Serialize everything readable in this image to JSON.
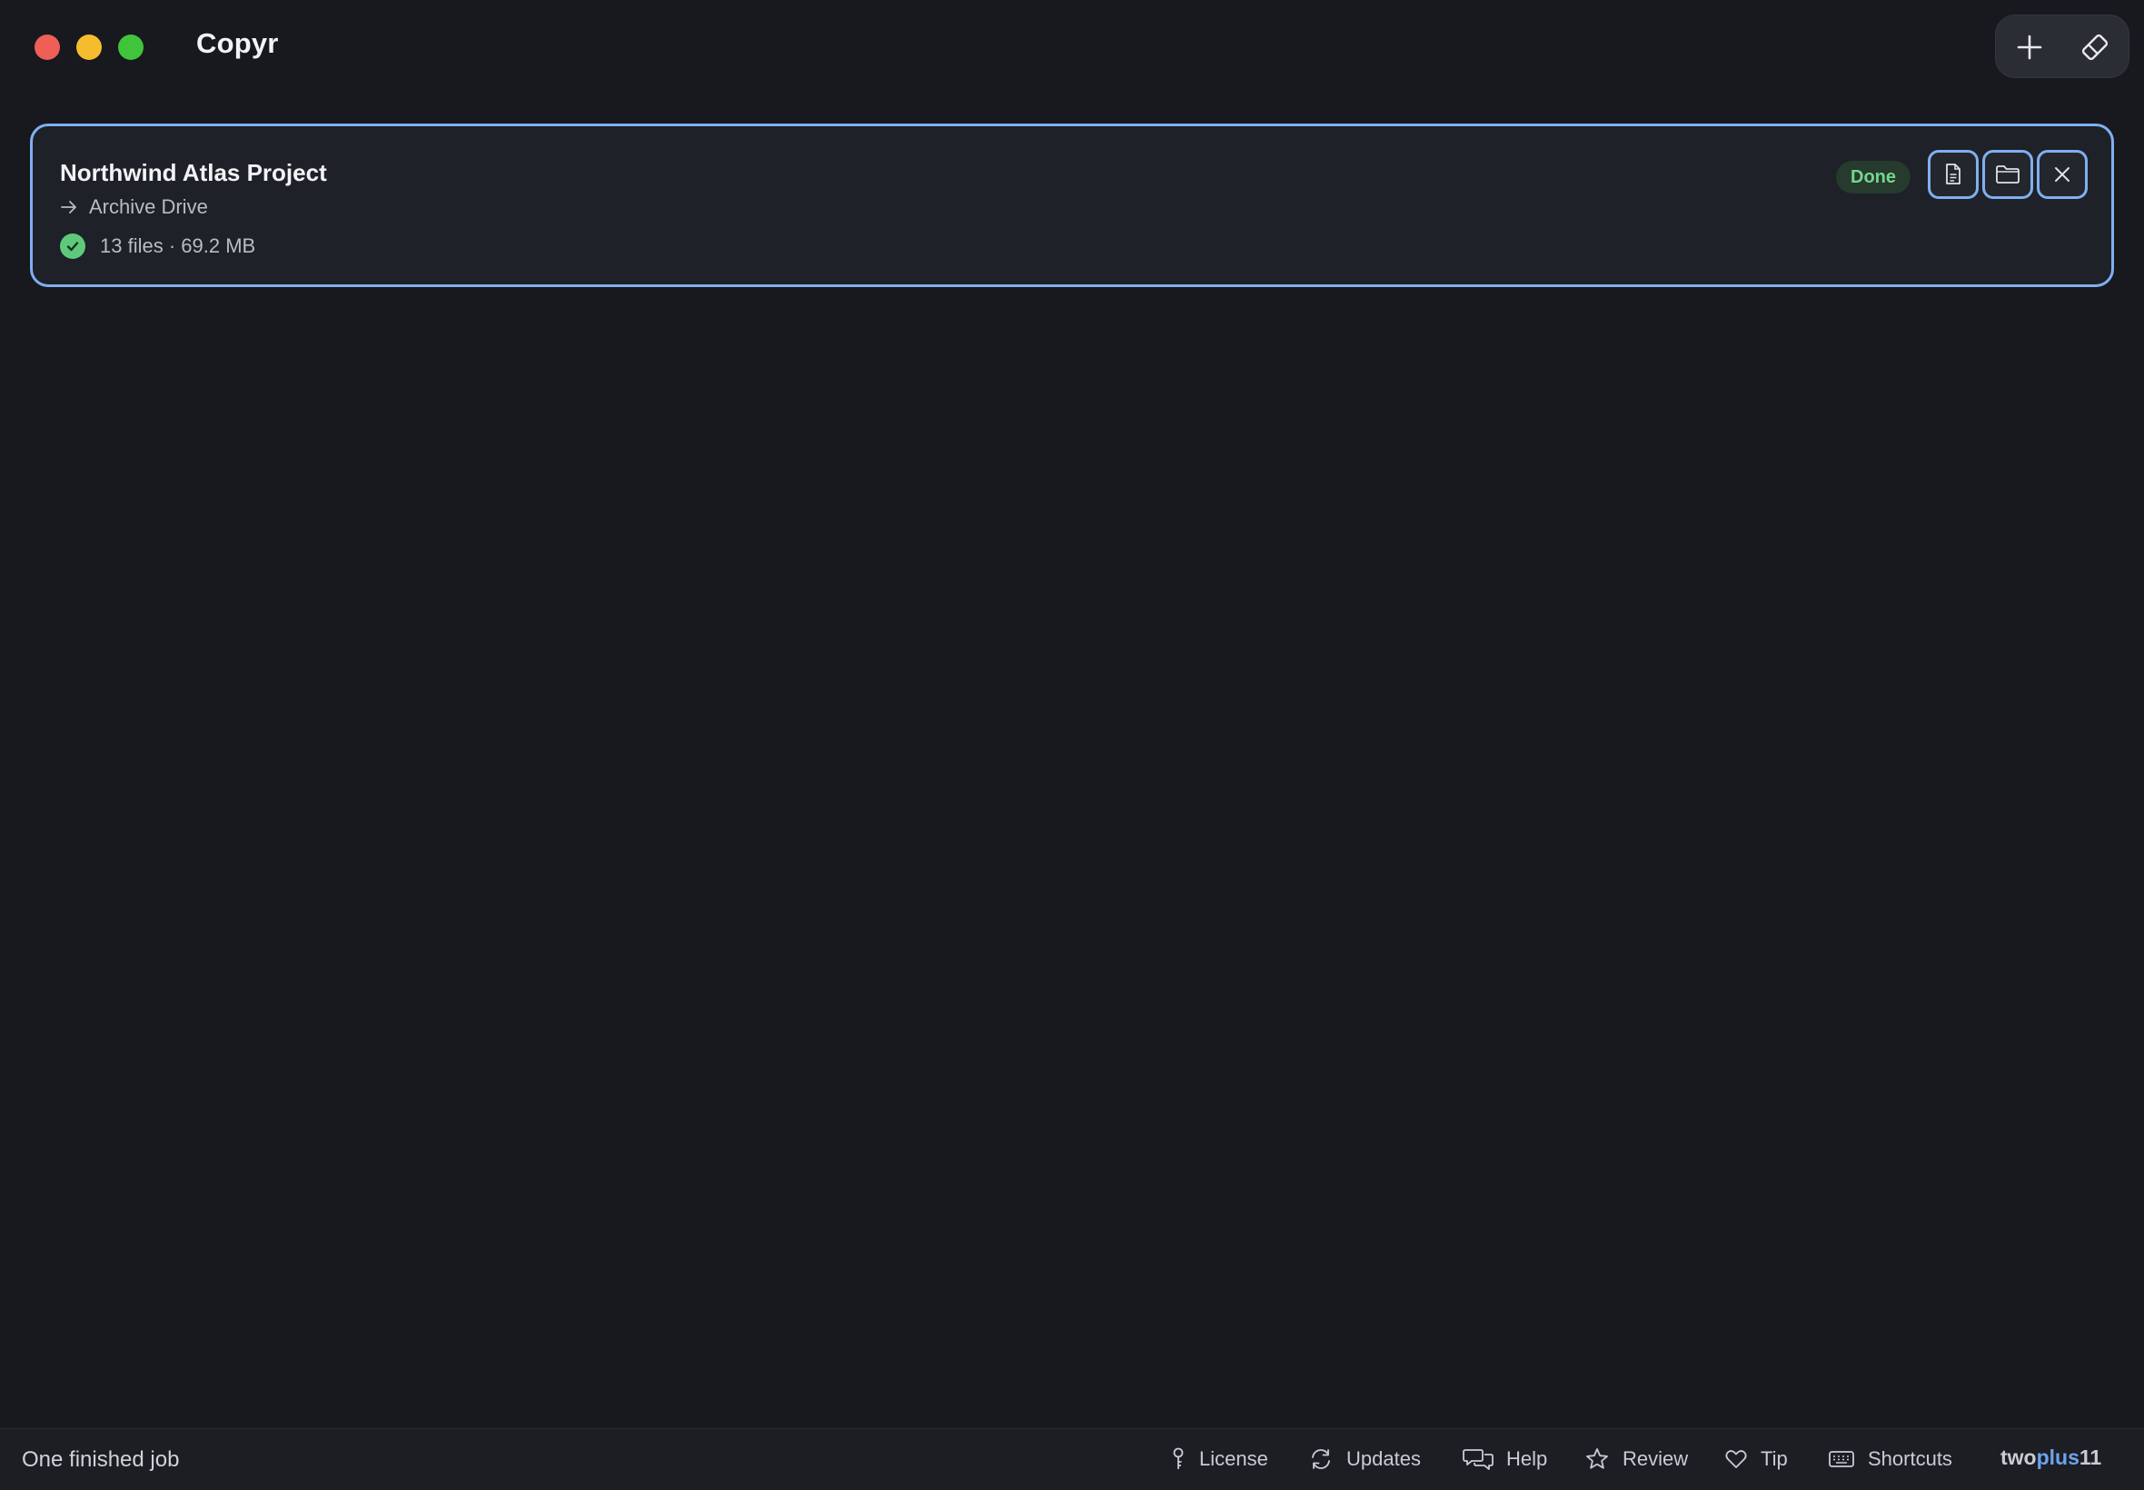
{
  "window": {
    "title": "Copyr"
  },
  "toolbar": {
    "add_icon": "plus-icon",
    "erase_icon": "eraser-icon"
  },
  "jobs": [
    {
      "title": "Northwind Atlas Project",
      "destination_arrow": "→",
      "destination": "Archive Drive",
      "summary": "13 files · 69.2 MB",
      "status": "Done",
      "status_color": "#74d68f",
      "actions": [
        "document-icon",
        "folder-icon",
        "close-icon"
      ]
    }
  ],
  "footer": {
    "status_text": "One finished job",
    "items": [
      {
        "label": "License",
        "icon": "key-icon"
      },
      {
        "label": "Updates",
        "icon": "refresh-icon"
      },
      {
        "label": "Help",
        "icon": "chat-bubbles-icon"
      },
      {
        "label": "Review",
        "icon": "star-icon"
      },
      {
        "label": "Tip",
        "icon": "heart-icon"
      },
      {
        "label": "Shortcuts",
        "icon": "keyboard-icon"
      }
    ],
    "brand": {
      "part1": "two",
      "part2": "plus",
      "part3": "11"
    }
  },
  "colors": {
    "background": "#17191e",
    "accent": "#7fb0f0",
    "success": "#5fc97b",
    "brand_blue": "#6da3ee"
  }
}
